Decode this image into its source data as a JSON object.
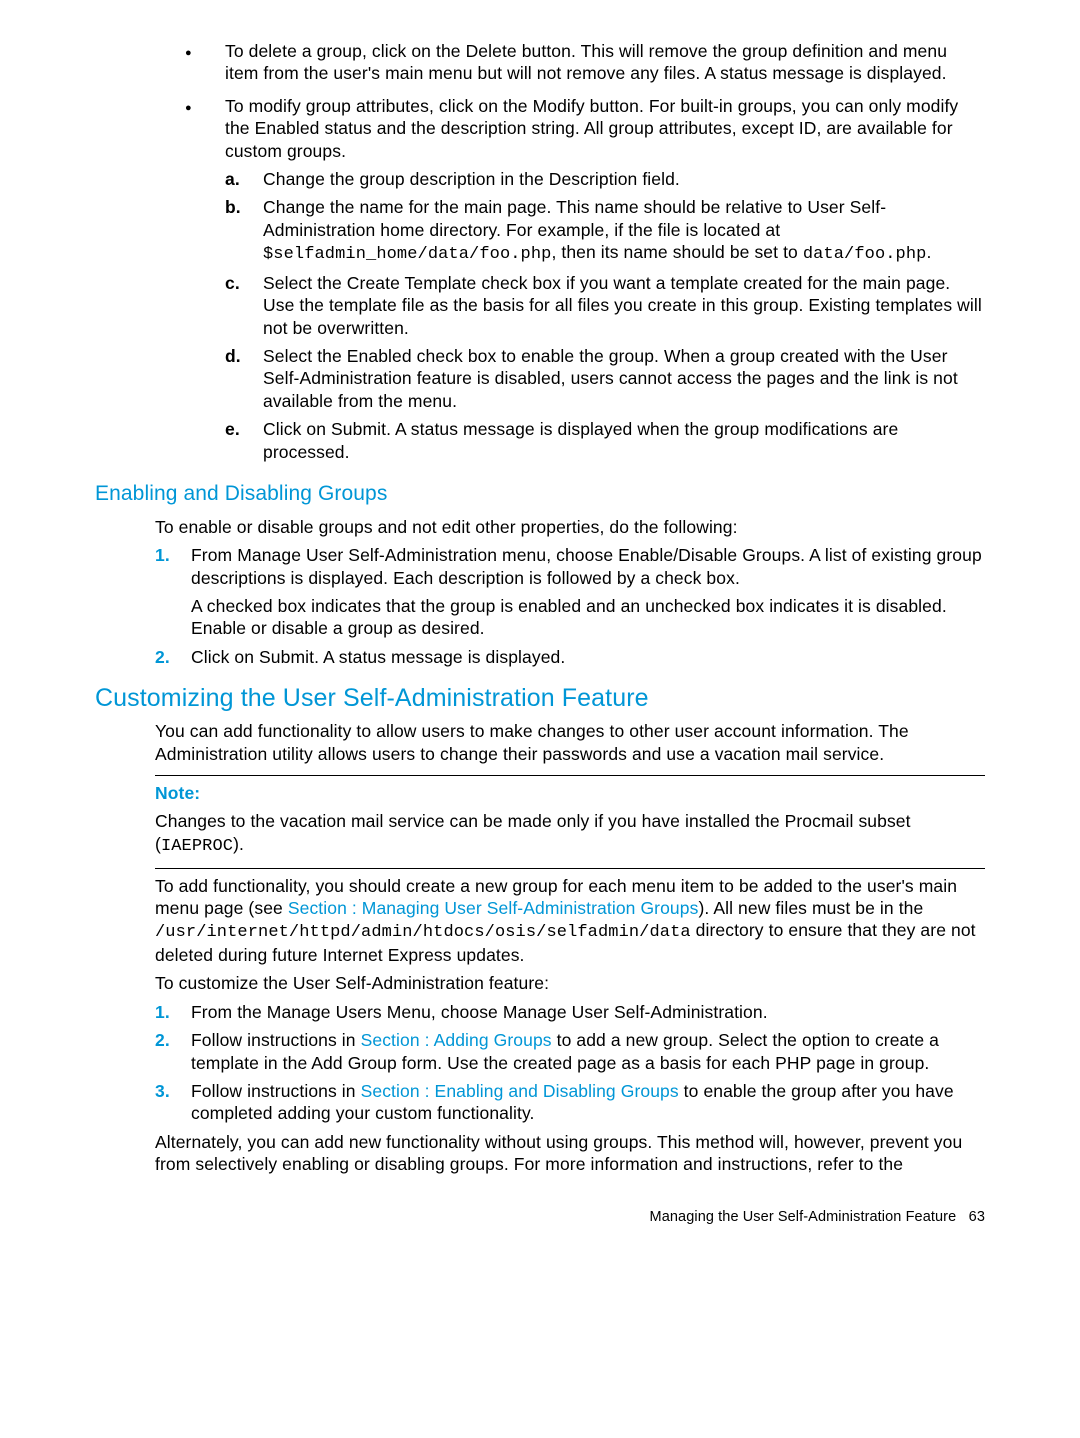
{
  "bullets": {
    "b1": "To delete a group, click on the Delete button. This will remove the group definition and menu item from the user's main menu but will not remove any files. A status message is displayed.",
    "b2_lead": "To modify group attributes, click on the Modify button. For built-in groups, you can only modify the Enabled status and the description string. All group attributes, except ID, are available for custom groups.",
    "b2_a": "Change the group description in the Description field.",
    "b2_b_pre": "Change the name for the main page. This name should be relative to User Self-Administration home directory. For example, if the file is located at ",
    "b2_b_code1": "$selfadmin_home/data/foo.php",
    "b2_b_mid": ", then its name should be set to ",
    "b2_b_code2": "data/foo.php",
    "b2_b_post": ".",
    "b2_c": "Select the Create Template check box if you want a template created for the main page. Use the template file as the basis for all files you create in this group. Existing templates will not be overwritten.",
    "b2_d": "Select the Enabled check box to enable the group. When a group created with the User Self-Administration feature is disabled, users cannot access the pages and the link is not available from the menu.",
    "b2_e": "Click on Submit. A status message is displayed when the group modifications are processed."
  },
  "enabling": {
    "heading": "Enabling and Disabling Groups",
    "intro": "To enable or disable groups and not edit other properties, do the following:",
    "n1_a": "From Manage User Self-Administration menu, choose Enable/Disable Groups. A list of existing group descriptions is displayed. Each description is followed by a check box.",
    "n1_b": "A checked box indicates that the group is enabled and an unchecked box indicates it is disabled. Enable or disable a group as desired.",
    "n2": "Click on Submit. A status message is displayed."
  },
  "custom": {
    "heading": "Customizing the User Self-Administration Feature",
    "p1": "You can add functionality to allow users to make changes to other user account information. The Administration utility allows users to change their passwords and use a vacation mail service.",
    "note_label": "Note:",
    "note_pre": "Changes to the vacation mail service can be made only if you have installed the Procmail subset (",
    "note_code": "IAEPROC",
    "note_post": ").",
    "p2_pre": "To add functionality, you should create a new group for each menu item to be added to the user's main menu page (see ",
    "p2_link": "Section : Managing User Self-Administration Groups",
    "p2_mid": "). All new files must be in the ",
    "p2_code": "/usr/internet/httpd/admin/htdocs/osis/selfadmin/data",
    "p2_post": " directory to ensure that they are not deleted during future Internet Express updates.",
    "p3": "To customize the User Self-Administration feature:",
    "s1": "From the Manage Users Menu, choose Manage User Self-Administration.",
    "s2_pre": "Follow instructions in ",
    "s2_link": "Section : Adding Groups",
    "s2_post": " to add a new group. Select the option to create a template in the Add Group form. Use the created page as a basis for each PHP page in group.",
    "s3_pre": "Follow instructions in ",
    "s3_link": "Section : Enabling and Disabling Groups",
    "s3_post": " to enable the group after you have completed adding your custom functionality.",
    "p4": "Alternately, you can add new functionality without using groups. This method will, however, prevent you from selectively enabling or disabling groups. For more information and instructions, refer to the"
  },
  "footer": {
    "text": "Managing the User Self-Administration Feature",
    "page": "63"
  },
  "markers": {
    "n1": "1.",
    "n2": "2.",
    "n3": "3.",
    "a": "a.",
    "b": "b.",
    "c": "c.",
    "d": "d.",
    "e": "e."
  }
}
